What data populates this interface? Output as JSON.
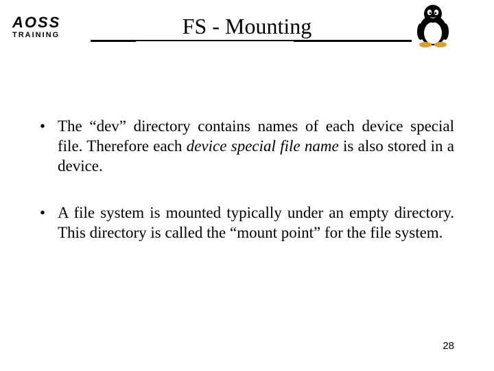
{
  "logo": {
    "main": "AOSS",
    "sub": "TRAINING"
  },
  "title": "FS - Mounting",
  "bullets": [
    {
      "lead": "The “dev” directory contains names of each device special file. Therefore each ",
      "italic": "device special file name",
      "tail": " is also stored in a device."
    },
    {
      "lead": "A file system is mounted typically under an empty directory. This directory is called the “mount point” for the file system.",
      "italic": "",
      "tail": ""
    }
  ],
  "pageNumber": "28"
}
